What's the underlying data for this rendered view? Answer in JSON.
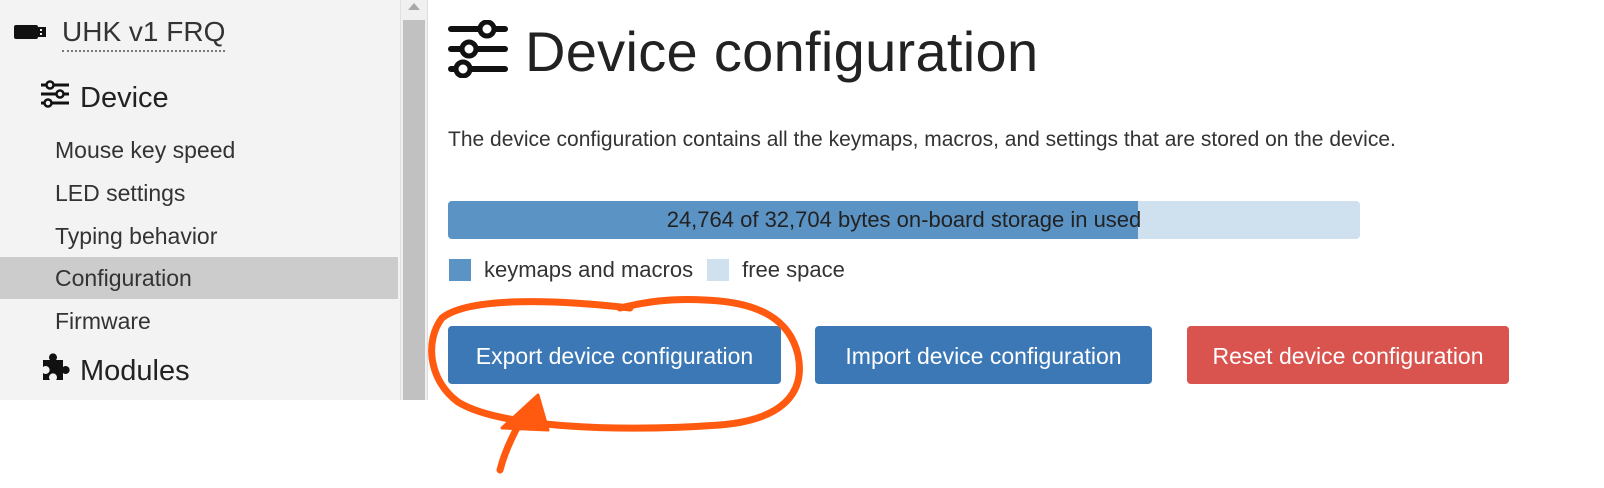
{
  "sidebar": {
    "device_name": "UHK v1 FRQ",
    "device_section": {
      "label": "Device",
      "icon": "sliders-icon"
    },
    "items": [
      {
        "label": "Mouse key speed"
      },
      {
        "label": "LED settings"
      },
      {
        "label": "Typing behavior"
      },
      {
        "label": "Configuration",
        "active": true
      },
      {
        "label": "Firmware"
      }
    ],
    "modules_section": {
      "label": "Modules",
      "icon": "puzzle-icon"
    }
  },
  "main": {
    "title": "Device configuration",
    "title_icon": "sliders-icon",
    "description": "The device configuration contains all the keymaps, macros, and settings that are stored on the device.",
    "storage": {
      "text": "24,764 of 32,704 bytes on-board storage in used",
      "used_fraction": 0.757
    },
    "legend": {
      "used_label": "keymaps and macros",
      "free_label": "free space"
    },
    "buttons": {
      "export": "Export device configuration",
      "import": "Import device configuration",
      "reset": "Reset device configuration"
    }
  },
  "colors": {
    "primary": "#3c78b5",
    "danger": "#d9534f",
    "used": "#5b93c4",
    "free": "#cfe0ef",
    "annotation": "#ff5a0f"
  }
}
